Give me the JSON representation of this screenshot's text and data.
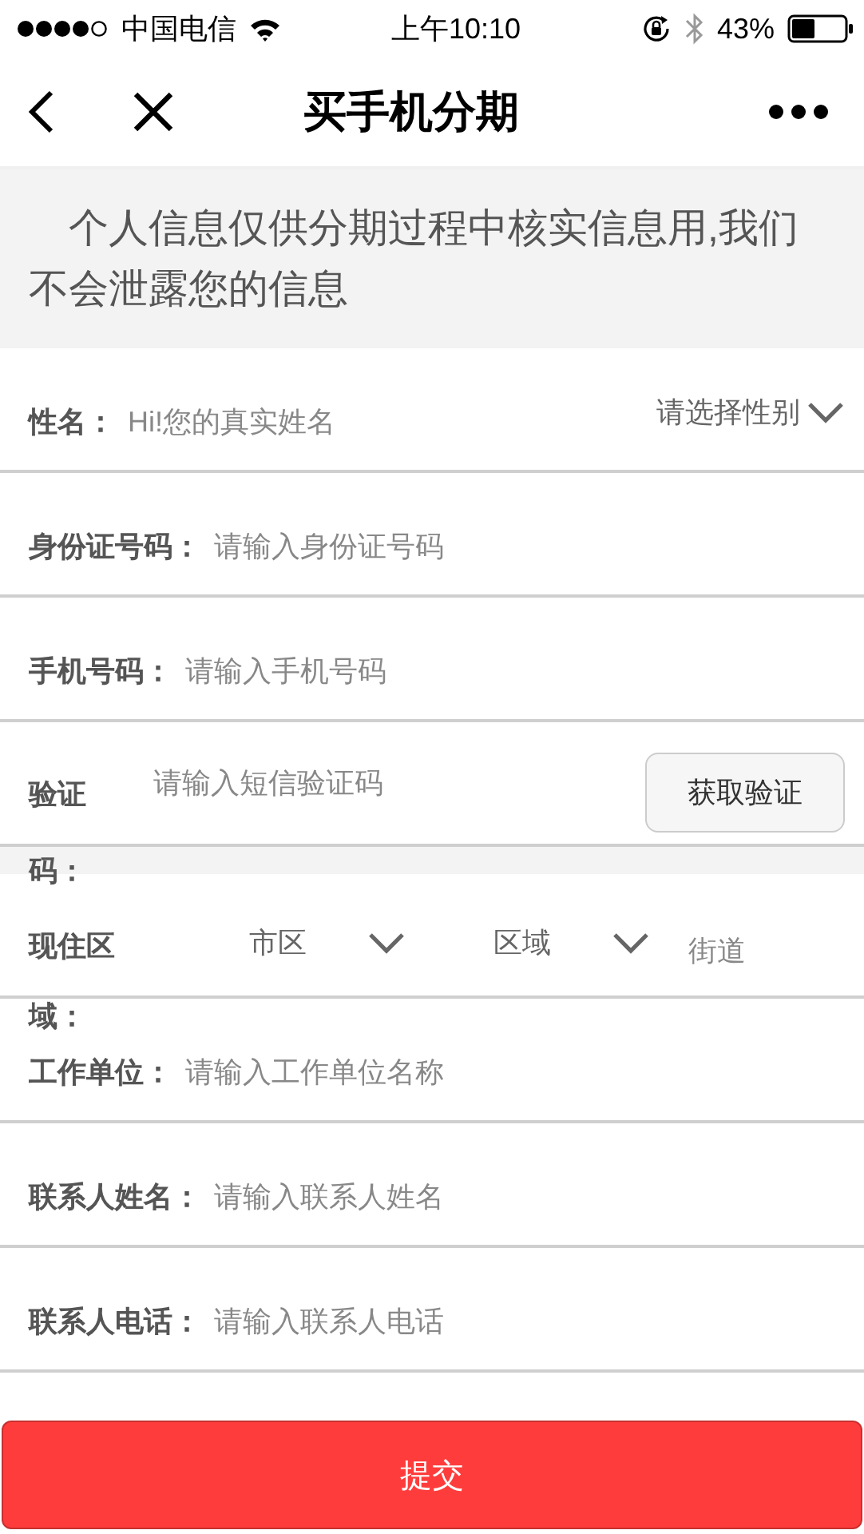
{
  "status_bar": {
    "carrier": "中国电信",
    "time": "上午10:10",
    "battery": "43%"
  },
  "nav": {
    "title": "买手机分期"
  },
  "notice": "个人信息仅供分期过程中核实信息用,我们不会泄露您的信息",
  "form": {
    "rows": [
      {
        "kind": "name",
        "label": "性名：",
        "placeholder": "Hi!您的真实姓名",
        "select": "请选择性别"
      },
      {
        "kind": "text",
        "label": "身份证号码：",
        "placeholder": "请输入身份证号码"
      },
      {
        "kind": "text",
        "label": "手机号码：",
        "placeholder": "请输入手机号码"
      },
      {
        "kind": "code",
        "label": "验证码：",
        "placeholder": "请输入短信验证码",
        "button": "获取验证"
      },
      {
        "kind": "address",
        "label": "现住区域：",
        "city": "市区",
        "district": "区域",
        "street_placeholder": "街道"
      },
      {
        "kind": "text",
        "label": "工作单位：",
        "placeholder": "请输入工作单位名称"
      },
      {
        "kind": "text",
        "label": "联系人姓名：",
        "placeholder": "请输入联系人姓名"
      },
      {
        "kind": "text",
        "label": "联系人电话：",
        "placeholder": "请输入联系人电话"
      }
    ]
  },
  "submit": "提交"
}
